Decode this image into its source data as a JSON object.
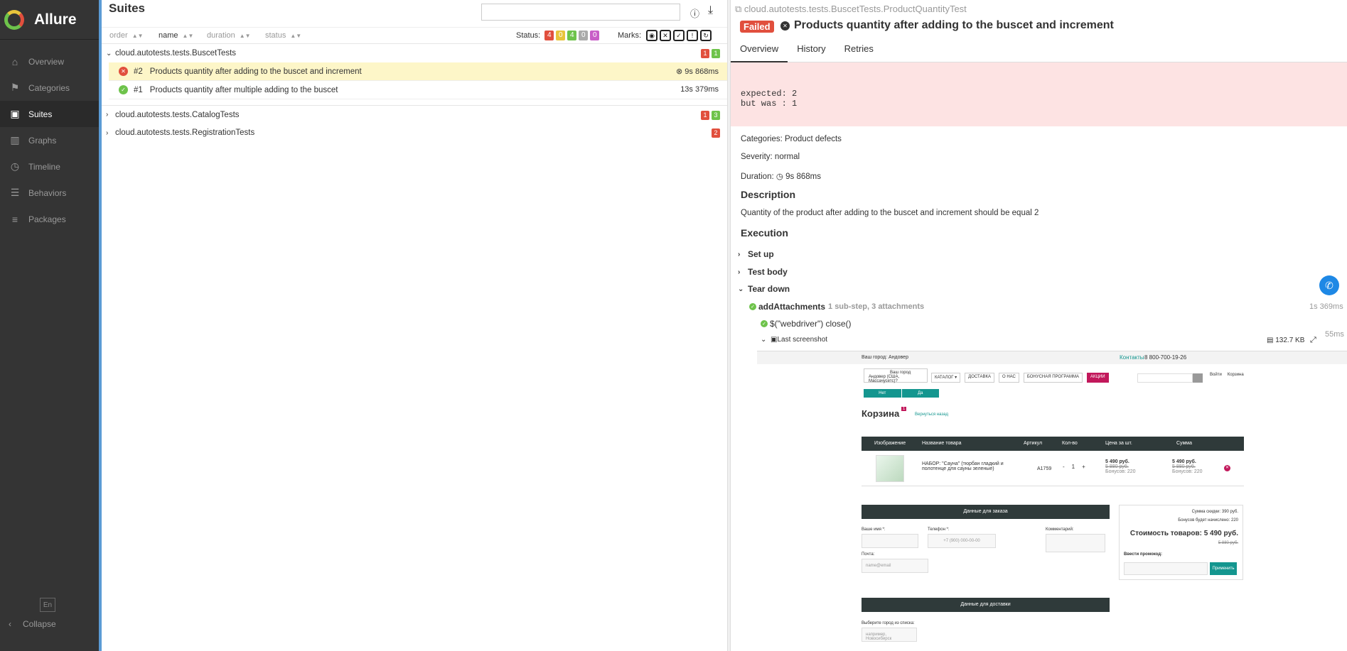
{
  "sidebar": {
    "brand": "Allure",
    "items": [
      {
        "label": "Overview"
      },
      {
        "label": "Categories"
      },
      {
        "label": "Suites"
      },
      {
        "label": "Graphs"
      },
      {
        "label": "Timeline"
      },
      {
        "label": "Behaviors"
      },
      {
        "label": "Packages"
      }
    ],
    "language": "En",
    "collapse": "Collapse"
  },
  "suites": {
    "title": "Suites",
    "sort": {
      "order": "order",
      "name": "name",
      "duration": "duration",
      "status": "status"
    },
    "status_label": "Status:",
    "status_counts": [
      {
        "value": "4",
        "color": "#e14f3d"
      },
      {
        "value": "0",
        "color": "#e8c43b"
      },
      {
        "value": "4",
        "color": "#6ec34b"
      },
      {
        "value": "0",
        "color": "#aaaaaa"
      },
      {
        "value": "0",
        "color": "#c85ec7"
      }
    ],
    "marks_label": "Marks:",
    "groups": [
      {
        "name": "cloud.autotests.tests.BuscetTests",
        "badges": [
          {
            "value": "1",
            "color": "#e14f3d"
          },
          {
            "value": "1",
            "color": "#6ec34b"
          }
        ],
        "rows": [
          {
            "num": "#2",
            "name": "Products quantity after adding to the buscet and increment",
            "duration": "9s 868ms",
            "status": "failed"
          },
          {
            "num": "#1",
            "name": "Products quantity after multiple adding to the buscet",
            "duration": "13s 379ms",
            "status": "passed"
          }
        ]
      },
      {
        "name": "cloud.autotests.tests.CatalogTests",
        "badges": [
          {
            "value": "1",
            "color": "#e14f3d"
          },
          {
            "value": "3",
            "color": "#6ec34b"
          }
        ]
      },
      {
        "name": "cloud.autotests.tests.RegistrationTests",
        "badges": [
          {
            "value": "2",
            "color": "#e14f3d"
          }
        ]
      }
    ]
  },
  "test": {
    "breadcrumb": "cloud.autotests.tests.BuscetTests.ProductQuantityTest",
    "status": "Failed",
    "title": "Products quantity after adding to the buscet and increment",
    "tabs": [
      "Overview",
      "History",
      "Retries"
    ],
    "error": "expected: 2\nbut was : 1",
    "categories": "Categories: Product defects",
    "severity": "Severity: normal",
    "duration_label": "Duration:",
    "duration": "9s 868ms",
    "description_heading": "Description",
    "description": "Quantity of the product after adding to the buscet and increment should be equal 2",
    "execution_heading": "Execution",
    "steps": {
      "setup": "Set up",
      "body": "Test body",
      "teardown": "Tear down",
      "add_attachments": "addAttachments",
      "add_attachments_meta": "1 sub-step, 3 attachments",
      "add_attachments_dur": "1s 369ms",
      "close_step": "$(\"webdriver\") close()",
      "close_dur": "55ms",
      "screenshot": "Last screenshot",
      "screenshot_size": "132.7 KB"
    }
  },
  "shot": {
    "city": "Ваш город: Андовер",
    "contacts": "Контакты",
    "phone": "8 800-700-19-26",
    "popup_q": "Ваш город",
    "popup_city": "Андовер (США, Массачусетс)?",
    "no": "Нет",
    "yes": "Да",
    "menu": [
      "КАТАЛОГ ▾",
      "ДОСТАВКА",
      "О НАС",
      "БОНУСНАЯ ПРОГРАММА",
      "АКЦИИ"
    ],
    "login": "Войти",
    "cart": "Корзина",
    "cart_title": "Корзина",
    "cart_count": "1",
    "back": "Вернуться назад",
    "headers": [
      "Изображение",
      "Название товара",
      "Артикул",
      "Кол-во",
      "Цена за шт.",
      "Сумма"
    ],
    "product_name": "НАБОР: \"Сауна\" (тюрбан гладкий и полотенце для сауны зеленые)",
    "article": "А1759",
    "qty_minus": "-",
    "qty": "1",
    "qty_plus": "+",
    "price": "5 490 руб.",
    "price_old": "5 880 руб.",
    "bonus": "Бонусов: 220",
    "order_data": "Данные для заказа",
    "name_label": "Ваше имя *:",
    "phone_label": "Телефон *:",
    "phone_placeholder": "+7 (900) 000-00-00",
    "comment_label": "Комментарий:",
    "email_label": "Почта:",
    "email_placeholder": "name@email",
    "discount": "Сумма скидки: 390 руб.",
    "bonus_accrued": "Бонусов будет начислено: 220",
    "total": "Стоимость товаров: 5 490 руб.",
    "total_old": "5 880 руб.",
    "promo": "Ввести промокод:",
    "apply": "Применить",
    "delivery_data": "Данные для доставки",
    "city_choose": "Выберите город из списка:",
    "city_placeholder": "например, Новосибирск"
  }
}
